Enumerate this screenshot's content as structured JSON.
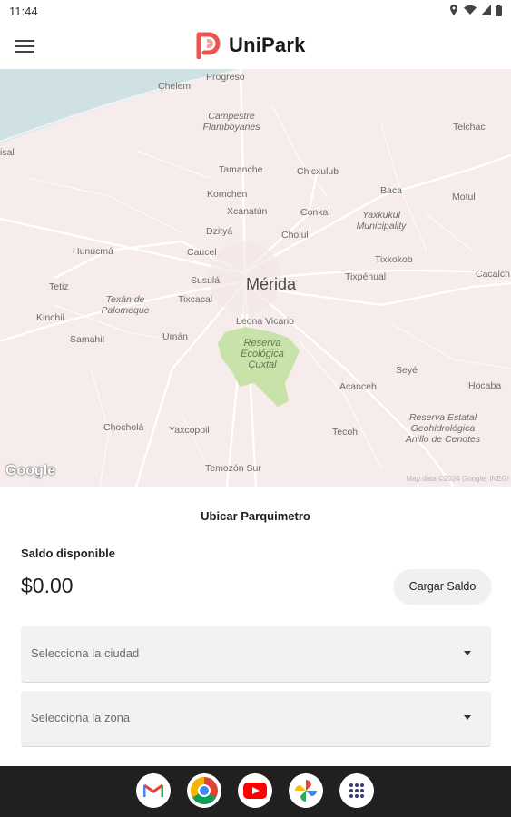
{
  "status_bar": {
    "time": "11:44"
  },
  "app_bar": {
    "brand_name": "UniPark"
  },
  "map": {
    "city": "Mérida",
    "labels": [
      "Progreso",
      "Chelem",
      "Campestre Flamboyanes",
      "Telchac",
      "isal",
      "Tamanche",
      "Chicxulub",
      "Komchen",
      "Baca",
      "Motul",
      "Xcanatún",
      "Conkal",
      "Yaxkukul Municipality",
      "Dzityá",
      "Cholul",
      "Hunucmá",
      "Caucel",
      "Tixkokob",
      "Susulá",
      "Tixpéhual",
      "Cacalch",
      "Tetiz",
      "Texán de Palomeque",
      "Tixcacal",
      "Kinchil",
      "Leona Vicario",
      "Samahil",
      "Umán",
      "Reserva Ecológica Cuxtal",
      "Seyé",
      "Acanceh",
      "Hocaba",
      "Chocholá",
      "Yaxcopoil",
      "Tecoh",
      "Reserva Estatal Geohidrológica Anillo de Cenotes",
      "Temozón Sur"
    ],
    "google_logo": "Google",
    "attribution": "Map data ©2024 Google, INEGI"
  },
  "main": {
    "section_title": "Ubicar Parquimetro",
    "saldo_label": "Saldo disponible",
    "saldo_value": "$0.00",
    "cargar_button": "Cargar Saldo",
    "city_select_placeholder": "Selecciona la ciudad",
    "zone_select_placeholder": "Selecciona la zona"
  },
  "dock": {
    "apps": [
      "gmail-icon",
      "chrome-icon",
      "youtube-icon",
      "photos-icon",
      "app-drawer-icon"
    ]
  },
  "colors": {
    "brand_red": "#ef5350",
    "map_bg": "#f7ecec",
    "water": "#cfe1e3",
    "reserve_green": "#c8e3a9"
  }
}
